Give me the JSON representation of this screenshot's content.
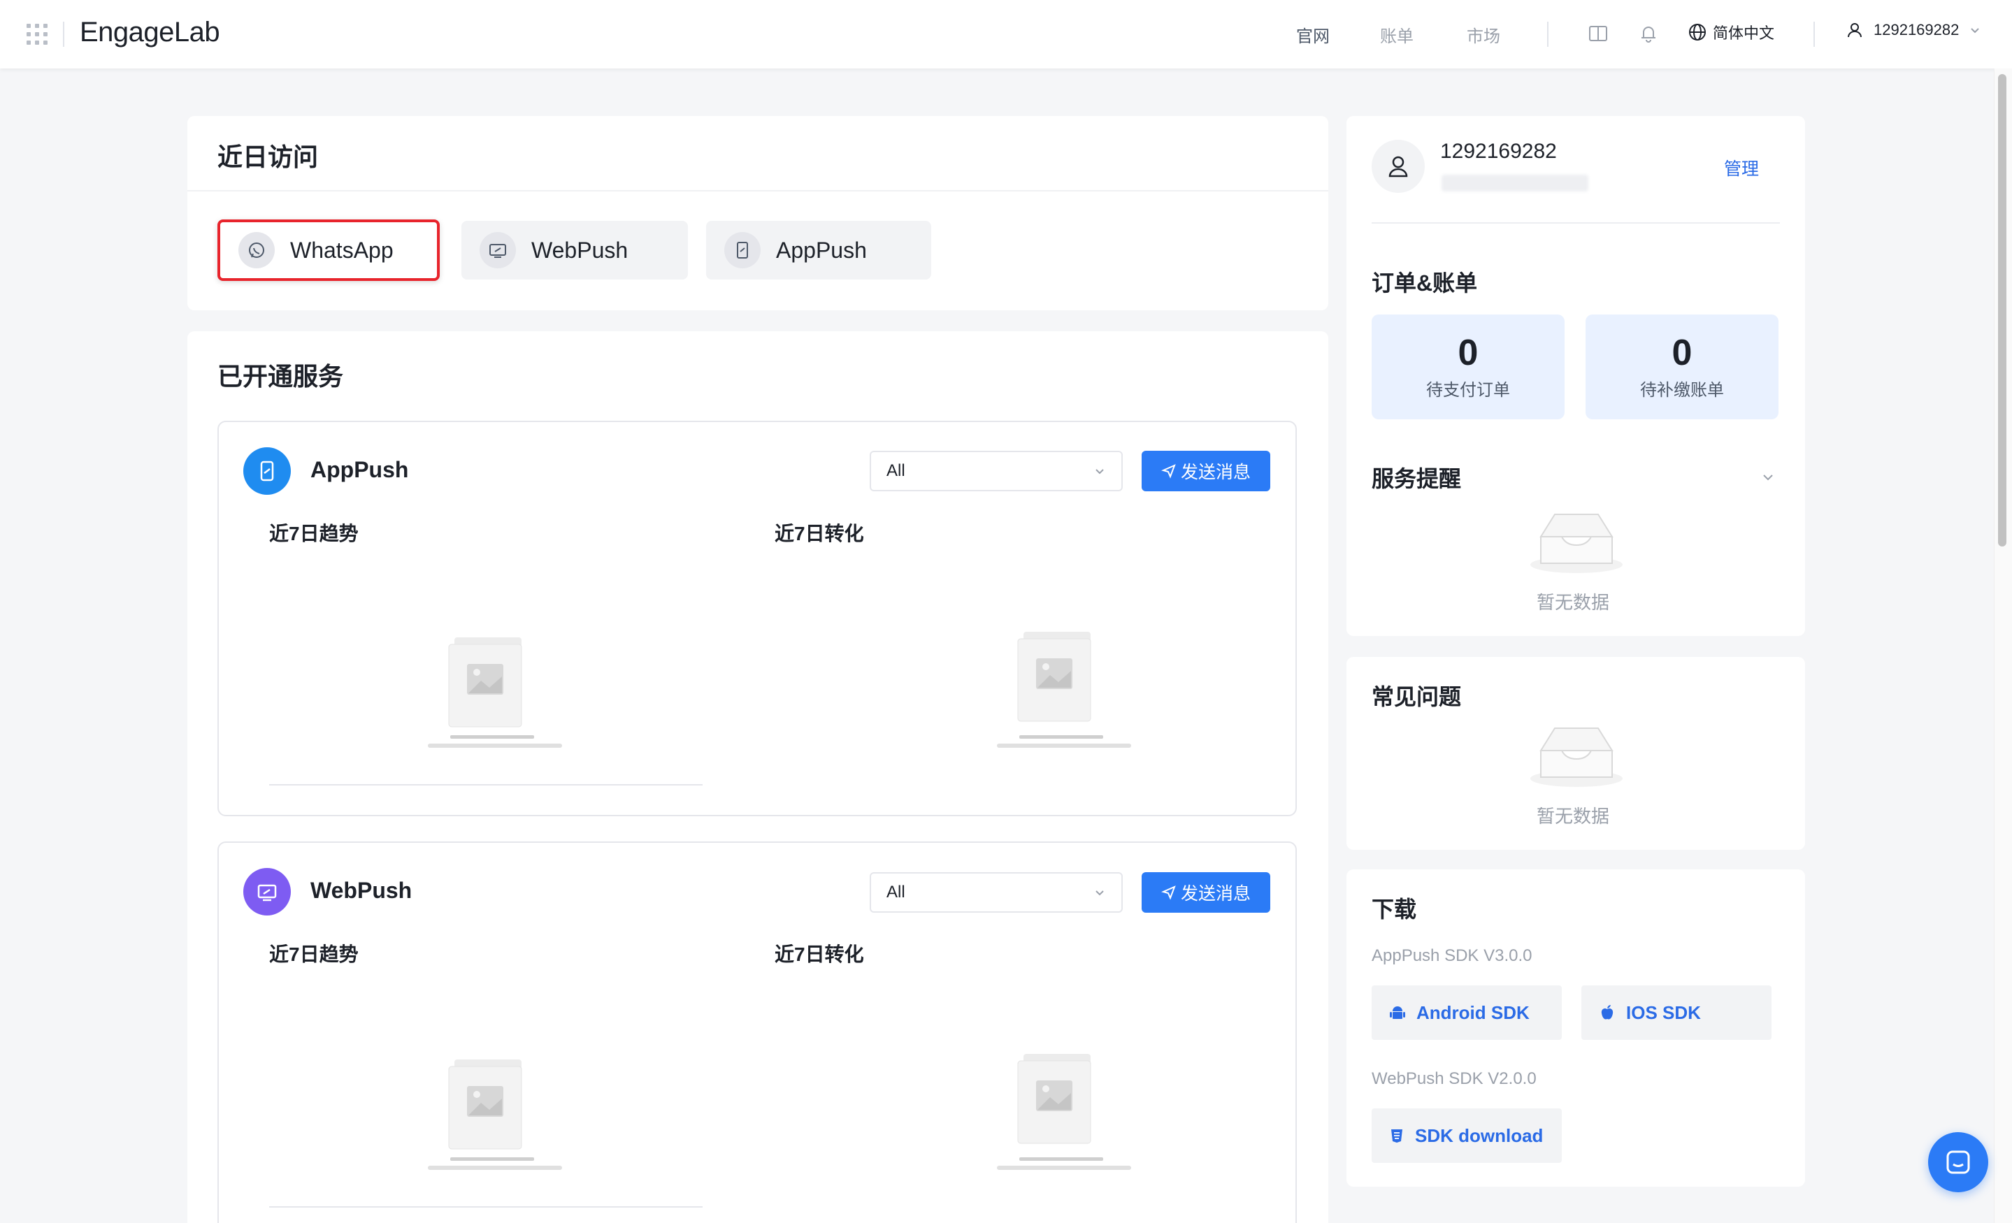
{
  "app": {
    "logo_main": "Engage",
    "logo_lab": "Lab"
  },
  "topnav": {
    "official_site": "官网",
    "bill": "账单",
    "market": "市场",
    "language": "简体中文",
    "username": "1292169282"
  },
  "recent": {
    "title": "近日访问",
    "items": [
      {
        "label": "WhatsApp",
        "icon": "whatsapp-icon",
        "highlighted": true
      },
      {
        "label": "WebPush",
        "icon": "monitor-icon"
      },
      {
        "label": "AppPush",
        "icon": "phone-icon"
      }
    ]
  },
  "services": {
    "title": "已开通服务",
    "list": [
      {
        "name": "AppPush",
        "select_value": "All",
        "send_label": "发送消息",
        "trend_label": "近7日趋势",
        "conversion_label": "近7日转化",
        "accent": "#1f8cf0"
      },
      {
        "name": "WebPush",
        "select_value": "All",
        "send_label": "发送消息",
        "trend_label": "近7日趋势",
        "conversion_label": "近7日转化",
        "accent": "#7e5cf2"
      }
    ]
  },
  "profile": {
    "username": "1292169282",
    "manage_label": "管理"
  },
  "orders": {
    "title": "订单&账单",
    "pending_payment": {
      "value": "0",
      "label": "待支付订单"
    },
    "pending_bills": {
      "value": "0",
      "label": "待补缴账单"
    }
  },
  "reminders": {
    "title": "服务提醒",
    "empty": "暂无数据"
  },
  "faq": {
    "title": "常见问题",
    "empty": "暂无数据"
  },
  "download": {
    "title": "下载",
    "apppush_sdk": "AppPush SDK V3.0.0",
    "android_btn": "Android SDK",
    "ios_btn": "IOS SDK",
    "webpush_sdk": "WebPush SDK V2.0.0",
    "sdk_download_btn": "SDK download"
  },
  "colors": {
    "primary": "#2b7bf6",
    "highlight_border": "#e8242c",
    "stat_bg": "#e9f1ff"
  }
}
